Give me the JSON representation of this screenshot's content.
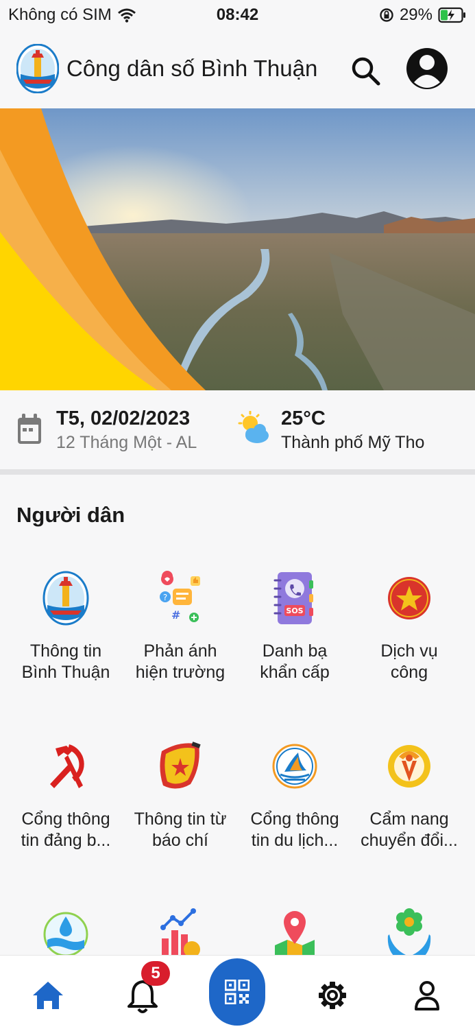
{
  "status_bar": {
    "carrier": "Không có SIM",
    "time": "08:42",
    "battery": "29%"
  },
  "header": {
    "title": "Công dân số Bình Thuận",
    "icons": [
      "logo-binh-thuan",
      "search-icon",
      "account-icon"
    ]
  },
  "info": {
    "date": "T5, 02/02/2023",
    "lunar_date": "12 Tháng Một - AL",
    "temperature": "25°C",
    "city": "Thành phố Mỹ Tho"
  },
  "section": {
    "title": "Người dân"
  },
  "services": [
    {
      "line1": "Thông tin",
      "line2": "Bình Thuận",
      "icon": "binh-thuan-logo-icon"
    },
    {
      "line1": "Phản ánh",
      "line2": "hiện trường",
      "icon": "feedback-icon"
    },
    {
      "line1": "Danh bạ",
      "line2": "khẩn cấp",
      "icon": "sos-phonebook-icon"
    },
    {
      "line1": "Dịch vụ",
      "line2": "công",
      "icon": "public-service-emblem-icon"
    },
    {
      "line1": "Cổng thông",
      "line2": "tin đảng b...",
      "icon": "hammer-sickle-icon"
    },
    {
      "line1": "Thông tin từ",
      "line2": "báo chí",
      "icon": "press-icon"
    },
    {
      "line1": "Cổng thông",
      "line2": "tin du lịch...",
      "icon": "tourism-icon"
    },
    {
      "line1": "Cẩm nang",
      "line2": "chuyển đổi...",
      "icon": "digital-handbook-icon"
    }
  ],
  "bottom_nav": {
    "notification_count": "5",
    "icons": [
      "home-icon",
      "bell-icon",
      "qr-code-icon",
      "gear-icon",
      "user-icon"
    ]
  },
  "colors": {
    "primary_blue": "#1e67c8",
    "badge_red": "#d81d2c",
    "banner_orange": "#f39a22",
    "banner_yellow": "#ffd500"
  }
}
